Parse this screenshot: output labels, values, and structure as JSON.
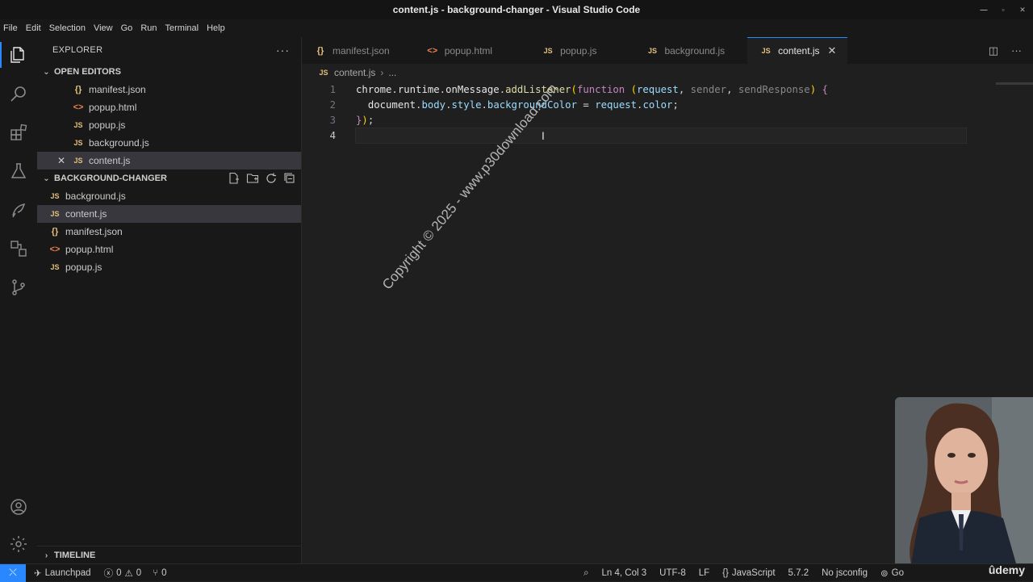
{
  "window": {
    "title": "content.js - background-changer - Visual Studio Code"
  },
  "menu": [
    "File",
    "Edit",
    "Selection",
    "View",
    "Go",
    "Run",
    "Terminal",
    "Help"
  ],
  "explorer": {
    "title": "EXPLORER",
    "open_editors_label": "OPEN EDITORS",
    "open_editors": [
      {
        "name": "manifest.json",
        "type": "json"
      },
      {
        "name": "popup.html",
        "type": "html"
      },
      {
        "name": "popup.js",
        "type": "js"
      },
      {
        "name": "background.js",
        "type": "js"
      },
      {
        "name": "content.js",
        "type": "js"
      }
    ],
    "folder_label": "BACKGROUND-CHANGER",
    "folder_files": [
      {
        "name": "background.js",
        "type": "js"
      },
      {
        "name": "content.js",
        "type": "js"
      },
      {
        "name": "manifest.json",
        "type": "json"
      },
      {
        "name": "popup.html",
        "type": "html"
      },
      {
        "name": "popup.js",
        "type": "js"
      }
    ],
    "timeline_label": "TIMELINE"
  },
  "tabs": [
    {
      "name": "manifest.json",
      "type": "json"
    },
    {
      "name": "popup.html",
      "type": "html"
    },
    {
      "name": "popup.js",
      "type": "js"
    },
    {
      "name": "background.js",
      "type": "js"
    },
    {
      "name": "content.js",
      "type": "js",
      "active": true
    }
  ],
  "breadcrumb": {
    "file": "content.js",
    "rest": "..."
  },
  "code_lines": [
    {
      "num": "1",
      "text": "chrome.runtime.onMessage.addListener(function (request, sender, sendResponse) {"
    },
    {
      "num": "2",
      "text": "  document.body.style.backgroundColor = request.color;"
    },
    {
      "num": "3",
      "text": "});"
    },
    {
      "num": "4",
      "text": ""
    }
  ],
  "watermark": "Copyright © 2025 - www.p30download.com",
  "status": {
    "launchpad": "Launchpad",
    "errors": "0",
    "warnings": "0",
    "ports": "0",
    "position": "Ln 4, Col 3",
    "encoding": "UTF-8",
    "eol": "LF",
    "language": "JavaScript",
    "version": "5.7.2",
    "jsconfig": "No jsconfig",
    "golive": "Go"
  },
  "branding": "ûdemy",
  "icon_glyphs": {
    "js": "JS",
    "json": "{}",
    "html": "<>"
  }
}
